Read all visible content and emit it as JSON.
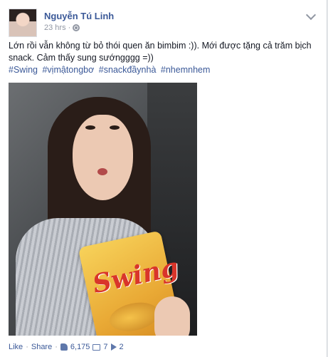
{
  "post": {
    "author": "Nguyễn Tú Linh",
    "time": "23 hrs",
    "visibility_icon": "globe-icon",
    "text": "Lớn rồi vẫn không từ bỏ thói quen ăn bimbim :)). Mới được tặng cả trăm bịch snack. Cảm thấy sung sướngggg =))",
    "hashtags": [
      "#Swing",
      "#vịmậtongbơ",
      "#snackđầynhà",
      "#nhemnhem"
    ],
    "photo": {
      "snack_brand": "Swing"
    }
  },
  "actions": {
    "like_label": "Like",
    "separator": "·",
    "share_label": "Share",
    "likes_count": "6,175",
    "comments_count": "7",
    "shares_count": "2"
  },
  "colors": {
    "link": "#3b5998",
    "meta": "#9197a3",
    "text": "#141823"
  }
}
